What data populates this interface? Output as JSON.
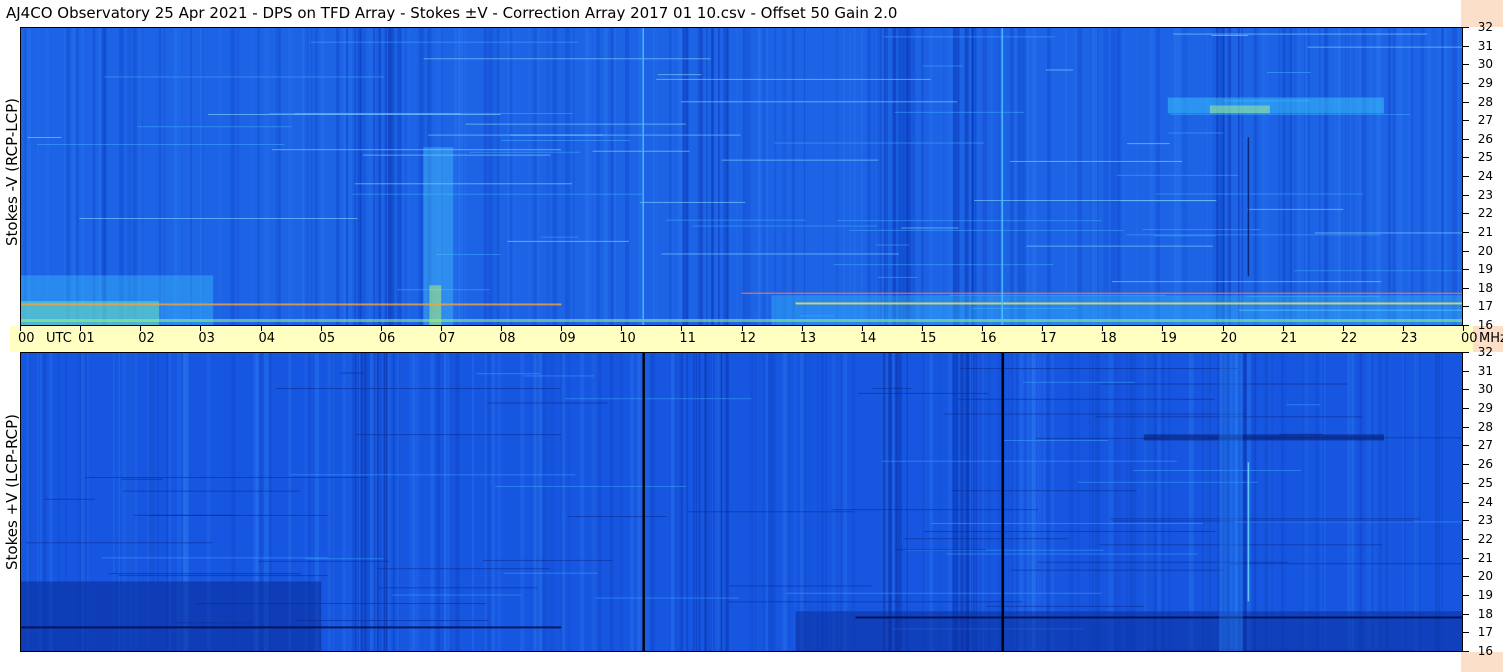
{
  "title": "AJ4CO Observatory  25 Apr 2021  -  DPS on TFD Array  -  Stokes ±V  -  Correction Array 2017 01 10.csv  -  Offset 50  Gain 2.0",
  "panels": {
    "top_ylabel": "Stokes -V (RCP-LCP)",
    "bottom_ylabel": "Stokes +V (LCP-RCP)"
  },
  "chart_data": [
    {
      "type": "heatmap",
      "title": "",
      "ylabel": "Stokes -V (RCP-LCP)",
      "x_ticks": [
        "00",
        "UTC",
        "01",
        "02",
        "03",
        "04",
        "05",
        "06",
        "07",
        "08",
        "09",
        "10",
        "11",
        "12",
        "13",
        "14",
        "15",
        "16",
        "17",
        "18",
        "19",
        "20",
        "21",
        "22",
        "23",
        "00"
      ],
      "y_ticks": [
        "32",
        "31",
        "30",
        "29",
        "28",
        "27",
        "26",
        "25",
        "24",
        "23",
        "22",
        "21",
        "20",
        "19",
        "18",
        "17",
        "16"
      ],
      "y_unit": "MHz",
      "xlim": [
        0,
        24
      ],
      "ylim": [
        16,
        32
      ],
      "colors": {
        "background": "#1a5de8",
        "hot": "#7cf0b0"
      }
    },
    {
      "type": "heatmap",
      "title": "",
      "ylabel": "Stokes +V (LCP-RCP)",
      "x_ticks": [
        "00",
        "UTC",
        "01",
        "02",
        "03",
        "04",
        "05",
        "06",
        "07",
        "08",
        "09",
        "10",
        "11",
        "12",
        "13",
        "14",
        "15",
        "16",
        "17",
        "18",
        "19",
        "20",
        "21",
        "22",
        "23",
        "00"
      ],
      "y_ticks": [
        "32",
        "31",
        "30",
        "29",
        "28",
        "27",
        "26",
        "25",
        "24",
        "23",
        "22",
        "21",
        "20",
        "19",
        "18",
        "17",
        "16"
      ],
      "y_unit": "MHz",
      "xlim": [
        0,
        24
      ],
      "ylim": [
        16,
        32
      ],
      "colors": {
        "background": "#1450d8",
        "dark": "#000830"
      }
    }
  ],
  "time_axis": {
    "labels": [
      "00",
      "UTC",
      "01",
      "02",
      "03",
      "04",
      "05",
      "06",
      "07",
      "08",
      "09",
      "10",
      "11",
      "12",
      "13",
      "14",
      "15",
      "16",
      "17",
      "18",
      "19",
      "20",
      "21",
      "22",
      "23",
      "00"
    ],
    "unit": "MHz"
  },
  "freq_axis": {
    "labels": [
      "32",
      "31",
      "30",
      "29",
      "28",
      "27",
      "26",
      "25",
      "24",
      "23",
      "22",
      "21",
      "20",
      "19",
      "18",
      "17",
      "16"
    ]
  }
}
